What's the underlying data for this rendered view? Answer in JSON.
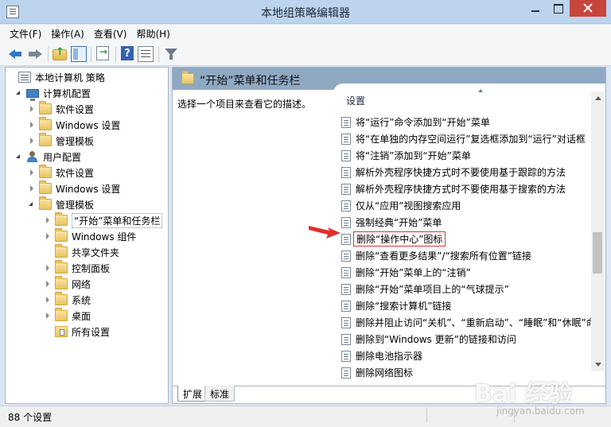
{
  "window": {
    "title": "本地组策略编辑器"
  },
  "menu": [
    "文件(F)",
    "操作(A)",
    "查看(V)",
    "帮助(H)"
  ],
  "toolbar": {
    "help_glyph": "?"
  },
  "tree": [
    {
      "label": "本地计算机 策略",
      "icon": "policy-icon",
      "level": 0,
      "expander": "none"
    },
    {
      "label": "计算机配置",
      "icon": "computer-icon",
      "level": 1,
      "expander": "open"
    },
    {
      "label": "软件设置",
      "icon": "folder-icon",
      "level": 2,
      "expander": "closed"
    },
    {
      "label": "Windows 设置",
      "icon": "folder-icon",
      "level": 2,
      "expander": "closed"
    },
    {
      "label": "管理模板",
      "icon": "folder-icon",
      "level": 2,
      "expander": "closed"
    },
    {
      "label": "用户配置",
      "icon": "user-icon",
      "level": 1,
      "expander": "open"
    },
    {
      "label": "软件设置",
      "icon": "folder-icon",
      "level": 2,
      "expander": "closed"
    },
    {
      "label": "Windows 设置",
      "icon": "folder-icon",
      "level": 2,
      "expander": "closed"
    },
    {
      "label": "管理模板",
      "icon": "folder-icon",
      "level": 2,
      "expander": "open"
    },
    {
      "label": "“开始”菜单和任务栏",
      "icon": "folder-icon",
      "level": 3,
      "expander": "closed",
      "selected": true
    },
    {
      "label": "Windows 组件",
      "icon": "folder-icon",
      "level": 3,
      "expander": "closed"
    },
    {
      "label": "共享文件夹",
      "icon": "folder-icon",
      "level": 3,
      "expander": "none"
    },
    {
      "label": "控制面板",
      "icon": "folder-icon",
      "level": 3,
      "expander": "closed"
    },
    {
      "label": "网络",
      "icon": "folder-icon",
      "level": 3,
      "expander": "closed"
    },
    {
      "label": "系统",
      "icon": "folder-icon",
      "level": 3,
      "expander": "closed"
    },
    {
      "label": "桌面",
      "icon": "folder-icon",
      "level": 3,
      "expander": "closed"
    },
    {
      "label": "所有设置",
      "icon": "settings-icon",
      "level": 3,
      "expander": "none"
    }
  ],
  "right_pane": {
    "header_title": "“开始”菜单和任务栏",
    "description": "选择一个项目来查看它的描述。",
    "column_header": "设置",
    "settings": [
      "将“运行”命令添加到“开始”菜单",
      "将“在单独的内存空间运行”复选框添加到“运行”对话框",
      "将“注销”添加到“开始”菜单",
      "解析外壳程序快捷方式时不要使用基于跟踪的方法",
      "解析外壳程序快捷方式时不要使用基于搜索的方法",
      "仅从“应用”视图搜索应用",
      "强制经典“开始”菜单",
      "删除“操作中心”图标",
      "删除“查看更多结果”/“搜索所有位置”链接",
      "删除“开始”菜单上的“注销”",
      "删除“开始”菜单项目上的“气球提示”",
      "删除“搜索计算机”链接",
      "删除并阻止访问“关机”、“重新启动”、“睡眠”和“休眠”命令",
      "删除到“Windows 更新”的链接和访问",
      "删除电池指示器",
      "删除网络图标"
    ],
    "highlighted_index": 7,
    "scroll_position": 0.6
  },
  "tabs": [
    "扩展",
    "标准"
  ],
  "status": {
    "text": "88 个设置"
  },
  "watermark": {
    "text": "Bai 经验",
    "sub": "jingyan.baidu.com"
  },
  "colors": {
    "annotation": "#e0302e",
    "header": "#8fa9c3",
    "title_bar": "#bcd4ee"
  }
}
